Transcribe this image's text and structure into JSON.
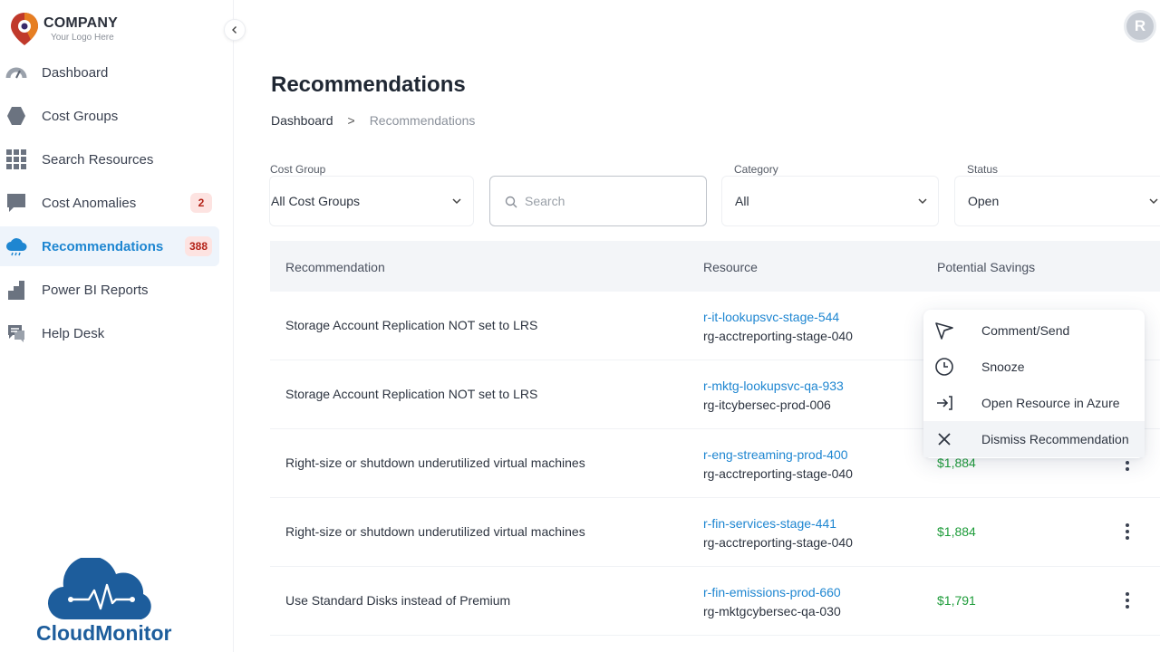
{
  "brand": {
    "company": "COMPANY",
    "tagline": "Your Logo Here",
    "product": "CloudMonitor",
    "accent": "#1e86d1"
  },
  "user": {
    "initial": "R"
  },
  "sidebar": {
    "items": [
      {
        "label": "Dashboard",
        "icon": "gauge-icon"
      },
      {
        "label": "Cost Groups",
        "icon": "hexagon-icon"
      },
      {
        "label": "Search Resources",
        "icon": "grid-icon"
      },
      {
        "label": "Cost Anomalies",
        "icon": "chat-bubble-icon",
        "badge": "2"
      },
      {
        "label": "Recommendations",
        "icon": "cloud-icon",
        "badge": "388",
        "active": true
      },
      {
        "label": "Power BI Reports",
        "icon": "bar-chart-icon"
      },
      {
        "label": "Help Desk",
        "icon": "help-chat-icon"
      }
    ]
  },
  "page": {
    "title": "Recommendations",
    "breadcrumb": {
      "home": "Dashboard",
      "separator": ">",
      "current": "Recommendations"
    }
  },
  "filters": {
    "cost_group": {
      "label": "Cost Group",
      "value": "All Cost Groups"
    },
    "search": {
      "placeholder": "Search"
    },
    "category": {
      "label": "Category",
      "value": "All"
    },
    "status": {
      "label": "Status",
      "value": "Open"
    }
  },
  "table": {
    "headers": {
      "recommendation": "Recommendation",
      "resource": "Resource",
      "savings": "Potential Savings"
    },
    "rows": [
      {
        "recommendation": "Storage Account Replication NOT set to LRS",
        "resource": "r-it-lookupsvc-stage-544",
        "group": "rg-acctreporting-stage-040",
        "savings": ""
      },
      {
        "recommendation": "Storage Account Replication NOT set to LRS",
        "resource": "r-mktg-lookupsvc-qa-933",
        "group": "rg-itcybersec-prod-006",
        "savings": ""
      },
      {
        "recommendation": "Right-size or shutdown underutilized virtual machines",
        "resource": "r-eng-streaming-prod-400",
        "group": "rg-acctreporting-stage-040",
        "savings": "$1,884"
      },
      {
        "recommendation": "Right-size or shutdown underutilized virtual machines",
        "resource": "r-fin-services-stage-441",
        "group": "rg-acctreporting-stage-040",
        "savings": "$1,884"
      },
      {
        "recommendation": "Use Standard Disks instead of Premium",
        "resource": "r-fin-emissions-prod-660",
        "group": "rg-mktgcybersec-qa-030",
        "savings": "$1,791"
      }
    ]
  },
  "context_menu": {
    "items": [
      {
        "label": "Comment/Send",
        "icon": "send-icon"
      },
      {
        "label": "Snooze",
        "icon": "clock-icon"
      },
      {
        "label": "Open Resource in Azure",
        "icon": "open-external-icon"
      },
      {
        "label": "Dismiss Recommendation",
        "icon": "close-icon"
      }
    ]
  }
}
